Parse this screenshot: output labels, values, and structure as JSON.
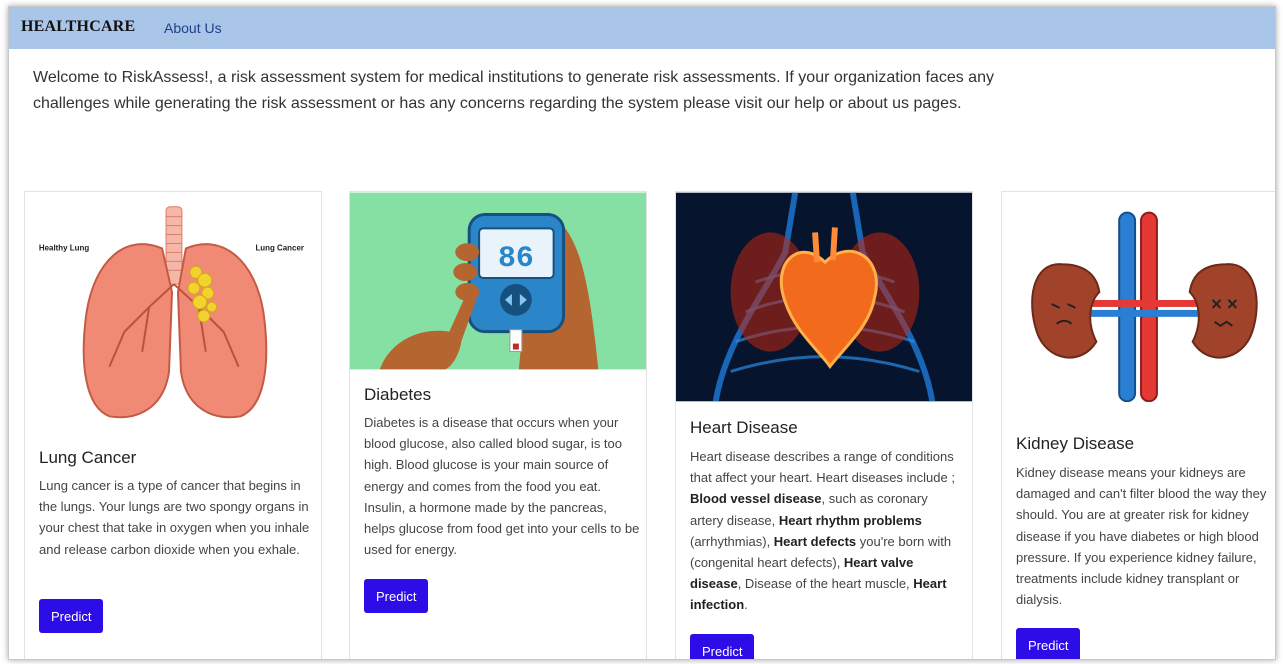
{
  "navbar": {
    "brand": "HEALTHCARE",
    "about_link": "About Us"
  },
  "welcome_text": "Welcome to RiskAssess!, a risk assessment system for medical institutions to generate risk assessments. If your organization faces any challenges while generating the risk assessment or has any concerns regarding the system please visit our help or about us pages.",
  "cards": [
    {
      "title": "Lung Cancer",
      "description": "Lung cancer is a type of cancer that begins in the lungs. Your lungs are two spongy organs in your chest that take in oxygen when you inhale and release carbon dioxide when you exhale.",
      "image_labels": {
        "left": "Healthy Lung",
        "right": "Lung Cancer"
      },
      "button_label": "Predict"
    },
    {
      "title": "Diabetes",
      "description": "Diabetes is a disease that occurs when your blood glucose, also called blood sugar, is too high. Blood glucose is your main source of energy and comes from the food you eat. Insulin, a hormone made by the pancreas, helps glucose from food get into your cells to be used for energy.",
      "meter_reading": "86",
      "button_label": "Predict"
    },
    {
      "title": "Heart Disease",
      "description_parts": [
        "Heart disease describes a range of conditions that affect your heart. Heart diseases include ; ",
        "Blood vessel disease",
        ", such as coronary artery disease, ",
        "Heart rhythm problems",
        " (arrhythmias), ",
        "Heart defects",
        " you're born with (congenital heart defects), ",
        "Heart valve disease",
        ", Disease of the heart muscle, ",
        "Heart infection",
        "."
      ],
      "button_label": "Predict"
    },
    {
      "title": "Kidney Disease",
      "description": "Kidney disease means your kidneys are damaged and can't filter blood the way they should. You are at greater risk for kidney disease if you have diabetes or high blood pressure. If you experience kidney failure, treatments include kidney transplant or dialysis.",
      "button_label": "Predict"
    }
  ],
  "colors": {
    "navbar_bg": "#a9c5e8",
    "button_bg": "#2c0de8",
    "diabetes_image_bg": "#86e0a3",
    "heart_image_bg": "#06142e"
  }
}
